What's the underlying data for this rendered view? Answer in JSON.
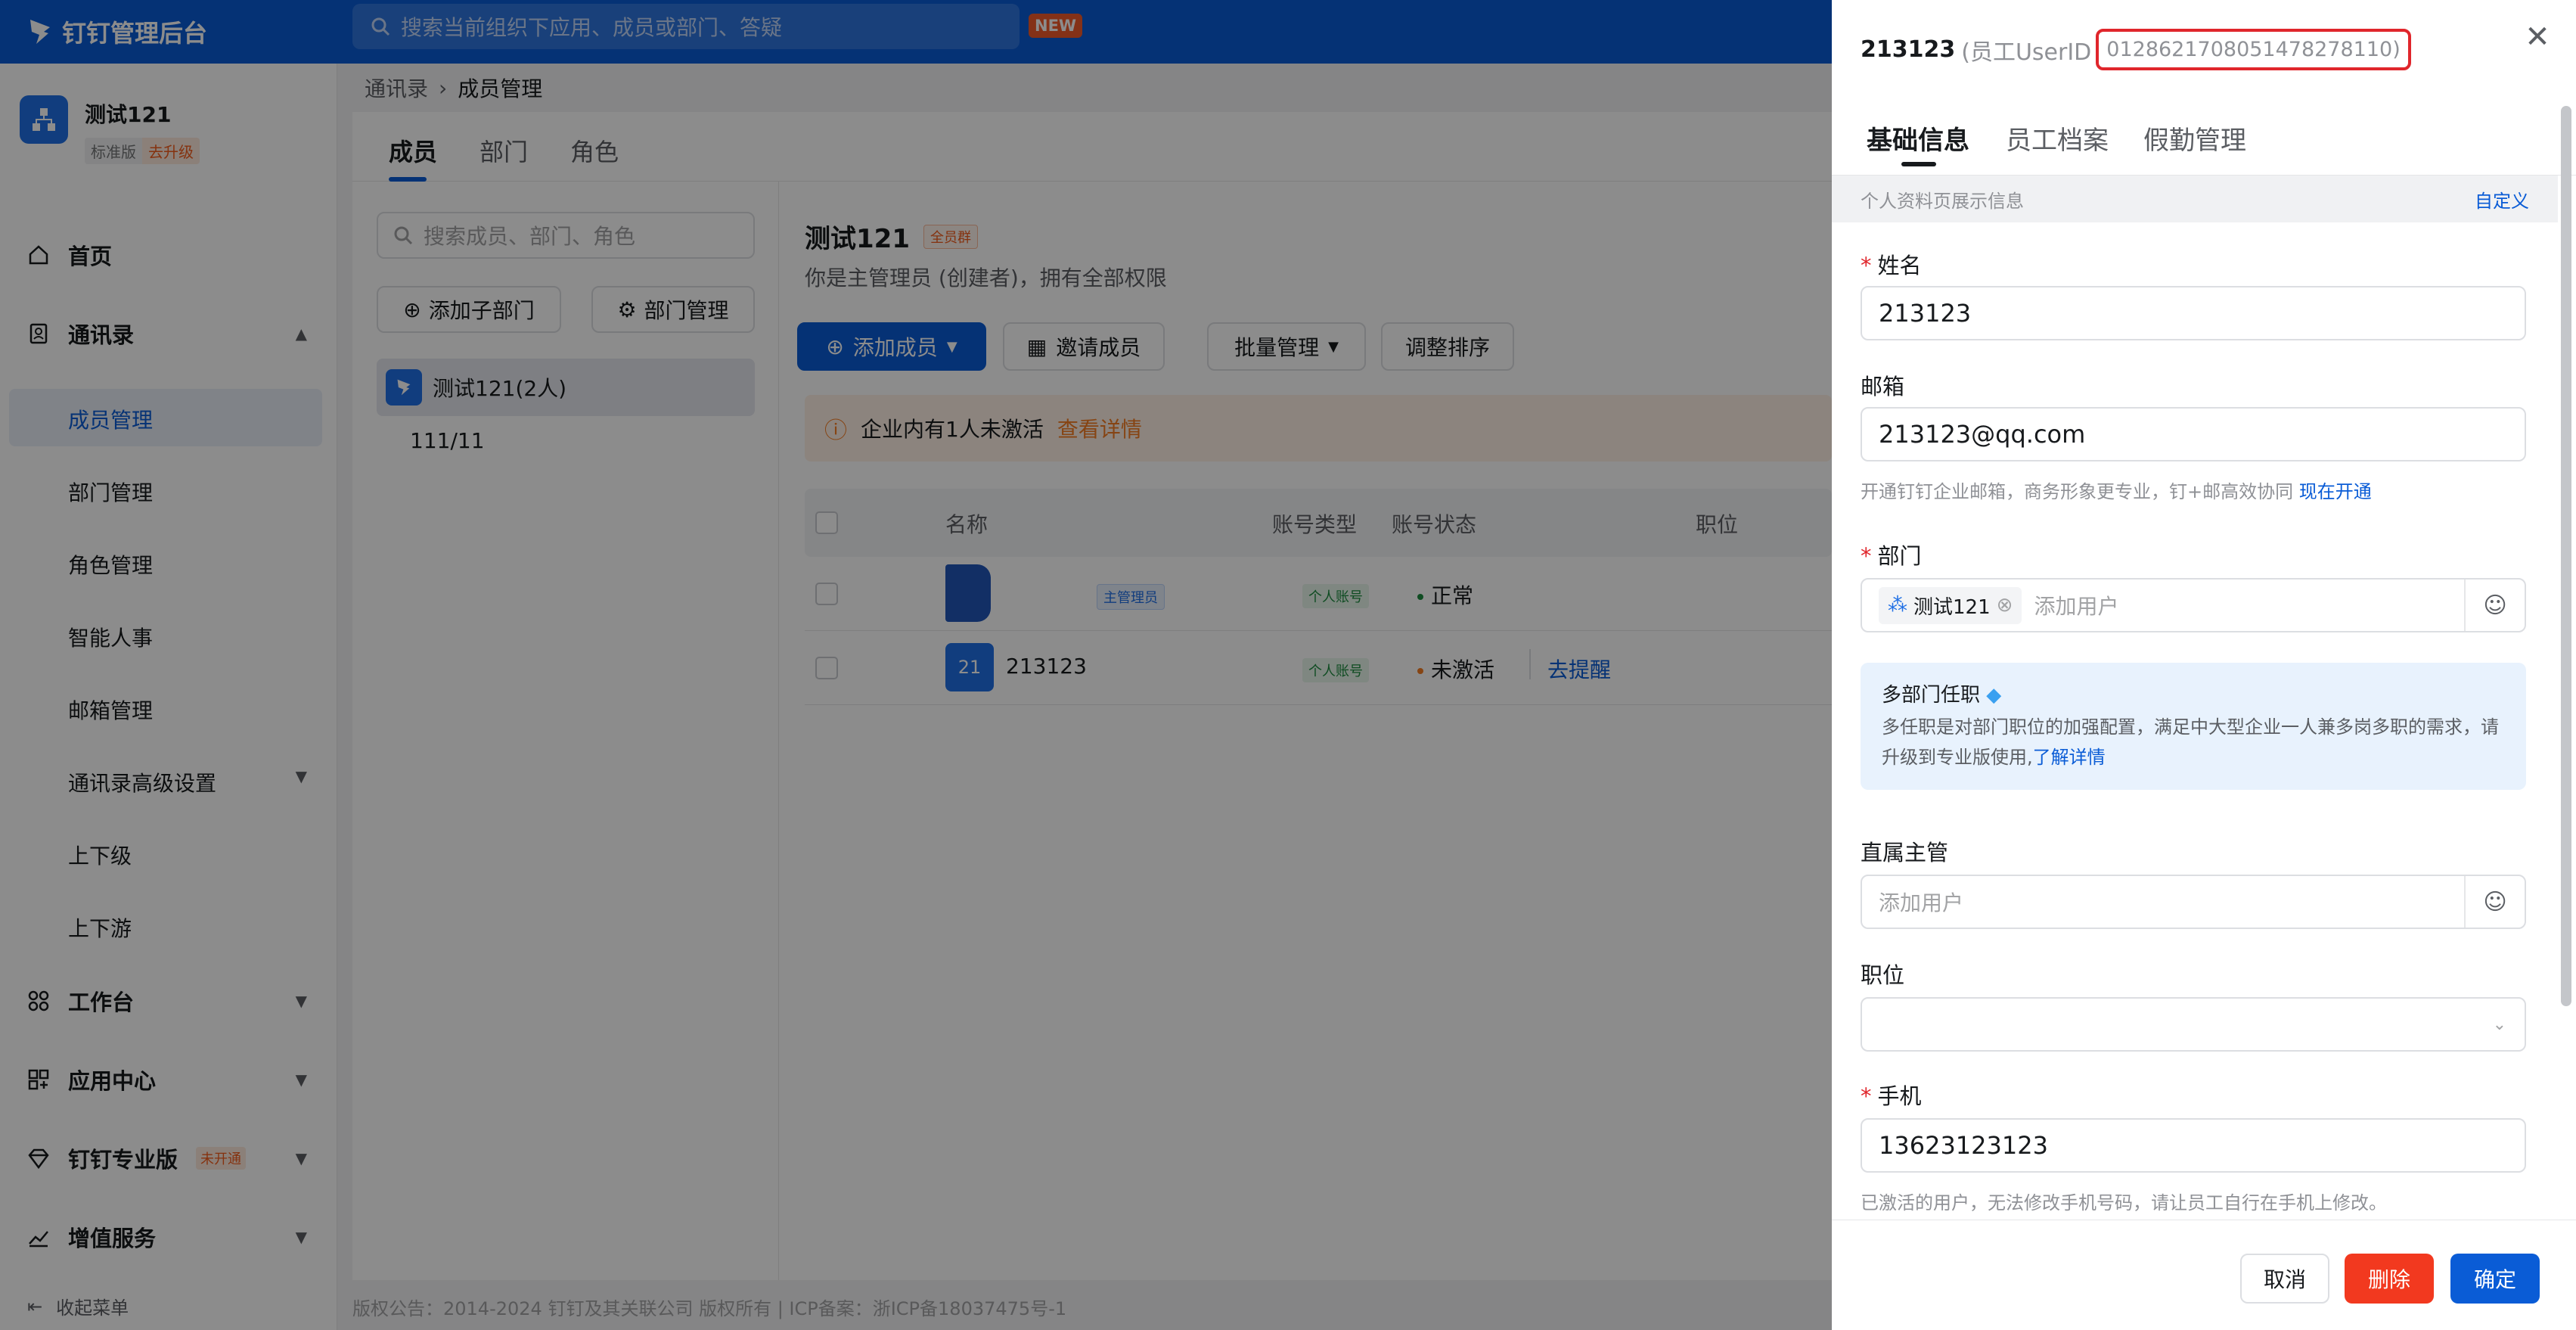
{
  "topbar": {
    "app_title": "钉钉管理后台",
    "search_placeholder": "搜索当前组织下应用、成员或部门、答疑",
    "new_badge": "NEW"
  },
  "org": {
    "name": "测试121",
    "plan": "标准版",
    "upgrade": "去升级"
  },
  "sidebar": {
    "home": "首页",
    "contacts": "通讯录",
    "contacts_items": [
      "成员管理",
      "部门管理",
      "角色管理",
      "智能人事",
      "邮箱管理",
      "通讯录高级设置",
      "上下级",
      "上下游"
    ],
    "workbench": "工作台",
    "app_center": "应用中心",
    "pro": "钉钉专业版",
    "pro_tag": "未开通",
    "value_added": "增值服务",
    "collapse": "收起菜单"
  },
  "breadcrumb": {
    "parent": "通讯录",
    "current": "成员管理"
  },
  "main_tabs": [
    "成员",
    "部门",
    "角色"
  ],
  "left_panel": {
    "search_placeholder": "搜索成员、部门、角色",
    "add_subdept": "添加子部门",
    "dept_manage": "部门管理",
    "root_dept": "测试121(2人)",
    "sub_dept": "111/11"
  },
  "right_panel": {
    "title": "测试121",
    "all_tag": "全员群",
    "desc": "你是主管理员 (创建者)，拥有全部权限",
    "buttons": {
      "add": "添加成员",
      "invite": "邀请成员",
      "batch": "批量管理",
      "sort": "调整排序"
    },
    "notice": {
      "text": "企业内有1人未激活",
      "link": "查看详情"
    },
    "columns": [
      "名称",
      "账号类型",
      "账号状态",
      "职位"
    ],
    "rows": [
      {
        "avatar": "",
        "name": "",
        "badge": "主管理员",
        "account_type": "个人账号",
        "status": "正常",
        "status_color": "#1c8b3e",
        "action": ""
      },
      {
        "avatar": "21",
        "name": "213123",
        "badge": "",
        "account_type": "个人账号",
        "status": "未激活",
        "status_color": "#f57d24",
        "action": "去提醒"
      }
    ]
  },
  "footer": "版权公告：2014-2024 钉钉及其关联公司 版权所有 | ICP备案：浙ICP备18037475号-1",
  "drawer": {
    "name": "213123",
    "uid_label": "(员工UserID",
    "uid_value": "012862170805147827811​0)",
    "tabs": [
      "基础信息",
      "员工档案",
      "假勤管理"
    ],
    "section": "个人资料页展示信息",
    "customize": "自定义",
    "fields": {
      "name_label": "姓名",
      "name_value": "213123",
      "email_label": "邮箱",
      "email_value": "213123@qq.com",
      "email_hint": "开通钉钉企业邮箱，商务形象更专业，钉+邮高效协同",
      "email_hint_link": "现在开通",
      "dept_label": "部门",
      "dept_tag": "测试121",
      "dept_placeholder": "添加用户",
      "multi_title": "多部门任职",
      "multi_desc": "多任职是对部门职位的加强配置，满足中大型企业一人兼多岗多职的需求，请升级到专业版使用,",
      "multi_link": "了解详情",
      "manager_label": "直属主管",
      "manager_placeholder": "添加用户",
      "position_label": "职位",
      "position_value": "",
      "phone_label": "手机",
      "phone_value": "13623123123",
      "phone_hint": "已激活的用户，无法修改手机号码，请让员工自行在手机上修改。"
    },
    "buttons": {
      "cancel": "取消",
      "delete": "删除",
      "confirm": "确定"
    }
  }
}
